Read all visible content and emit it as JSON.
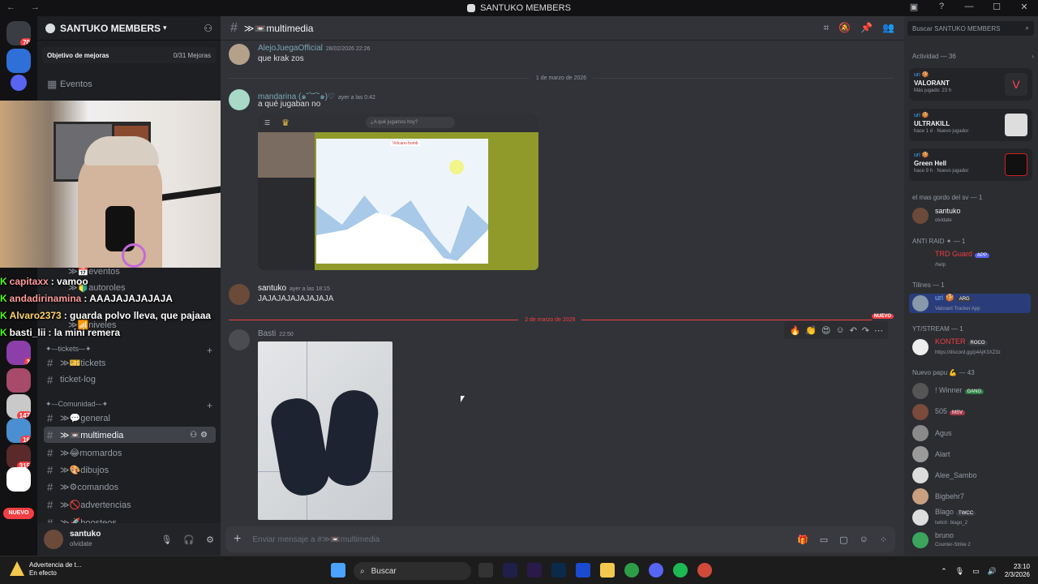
{
  "window": {
    "title": "SANTUKO MEMBERS"
  },
  "server": {
    "name": "SANTUKO MEMBERS",
    "goal_label": "Objetivo de mejoras",
    "goal_progress": "0/31 Mejoras"
  },
  "channels_top": [
    {
      "label": "Eventos"
    }
  ],
  "overlay_channels": [
    {
      "label": "≫📅eventos"
    },
    {
      "label": "≫🔰autoroles"
    },
    {
      "label": "≫📶niveles"
    }
  ],
  "cat_tickets": "✦-–tickets-–✦",
  "channels_tickets": [
    {
      "label": "≫🎫tickets"
    },
    {
      "label": "ticket-log"
    }
  ],
  "cat_comunidad": "✦-–Comunidad-–✦",
  "channels_comunidad": [
    {
      "label": "≫💬general"
    },
    {
      "label": "≫📼multimedia"
    },
    {
      "label": "≫😂momardos"
    },
    {
      "label": "≫🎨dibujos"
    },
    {
      "label": "≫⚙comandos"
    },
    {
      "label": "≫🚫advertencias"
    },
    {
      "label": "≫🚀boosteos"
    }
  ],
  "user": {
    "name": "santuko",
    "status": "olvidate"
  },
  "overlay_chat": [
    {
      "name": "capitaxx",
      "text": ": vamoo"
    },
    {
      "name": "andadirinamina",
      "text": ": AAAJAJAJAJAJA"
    },
    {
      "name": "Alvaro2373",
      "text": ": guarda polvo lleva, que pajaaa"
    },
    {
      "name": "basti_lii",
      "text": ": la mini remera"
    }
  ],
  "rail_badges": [
    "70",
    "3",
    "147",
    "16",
    "315",
    "16",
    "NUEVO"
  ],
  "channel": {
    "name": "≫📼multimedia",
    "composer_placeholder": "Enviar mensaje a #≫📼multimedia"
  },
  "messages": [
    {
      "author": "AlejoJuegaOfficial",
      "time": "28/02/2026 22:26",
      "text": "que krak zos"
    },
    {
      "author": "mandarina (๑˘︶˘๑)♡",
      "time": "ayer a las 0:42",
      "text": "a qué jugaban no"
    },
    {
      "author": "santuko",
      "time": "ayer a las 18:15",
      "text": "JAJAJAJAJAJAJAJA"
    },
    {
      "author": "Basti",
      "time": "22:50",
      "text": ""
    }
  ],
  "date_separators": [
    "1 de marzo de 2026",
    "2 de marzo de 2026"
  ],
  "new_badge": "NUEVO",
  "embed": {
    "search_placeholder": "¿A qué jugamos hoy?",
    "game_title": "Volcano bomb"
  },
  "right": {
    "search_placeholder": "Buscar SANTUKO MEMBERS",
    "activity_label": "Actividad — 36",
    "activities": [
      {
        "user": "uri 🍪",
        "game": "VALORANT",
        "status": "Más jugado: 23 h"
      },
      {
        "user": "uri 🍪",
        "game": "ULTRAKILL",
        "status": "hace 1 d · Nuevo jugador"
      },
      {
        "user": "uri 🍪",
        "game": "Green Hell",
        "status": "hace 9 h · Nuevo jugador"
      }
    ],
    "groups": [
      {
        "label": "el mas gordo del sv — 1",
        "members": [
          {
            "name": "santuko",
            "status": "olvidate",
            "tag": ""
          }
        ]
      },
      {
        "label": "ANTI RAID ✦ — 1",
        "members": [
          {
            "name": "TRD Guard",
            "status": "/help",
            "tag": "APP"
          }
        ]
      },
      {
        "label": "Tilines — 1",
        "members": [
          {
            "name": "uri 🍪",
            "status": "Valorant Tracker App",
            "tag": "ARG"
          }
        ]
      },
      {
        "label": "YT/STREAM — 1",
        "members": [
          {
            "name": "KONTER",
            "status": "https://discord.gg/p4AjK3XZ3z",
            "tag": "ROCO"
          }
        ]
      },
      {
        "label": "Nuevo papu 💪 — 43",
        "members": [
          {
            "name": "! Winner",
            "status": "",
            "tag": "GANG"
          },
          {
            "name": "505",
            "status": "",
            "tag": "MSV"
          },
          {
            "name": "Agus",
            "status": "",
            "tag": ""
          },
          {
            "name": "Alart",
            "status": "",
            "tag": ""
          },
          {
            "name": "Alee_Sambo",
            "status": "",
            "tag": ""
          },
          {
            "name": "Bigbehr7",
            "status": "",
            "tag": ""
          },
          {
            "name": "Blago",
            "status": "twitch: blago_2",
            "tag": "TWCC"
          },
          {
            "name": "bruno",
            "status": "Counter-Strike 2",
            "tag": ""
          }
        ]
      }
    ]
  },
  "taskbar": {
    "notif_title": "Advertencia de t...",
    "notif_sub": "En efecto",
    "search": "Buscar",
    "time": "23:10",
    "date": "2/3/2026"
  },
  "colors": {
    "accent": "#5865f2",
    "bg_main": "#323338",
    "bg_sidebar": "#1e1f22",
    "new_red": "#f23f43"
  }
}
